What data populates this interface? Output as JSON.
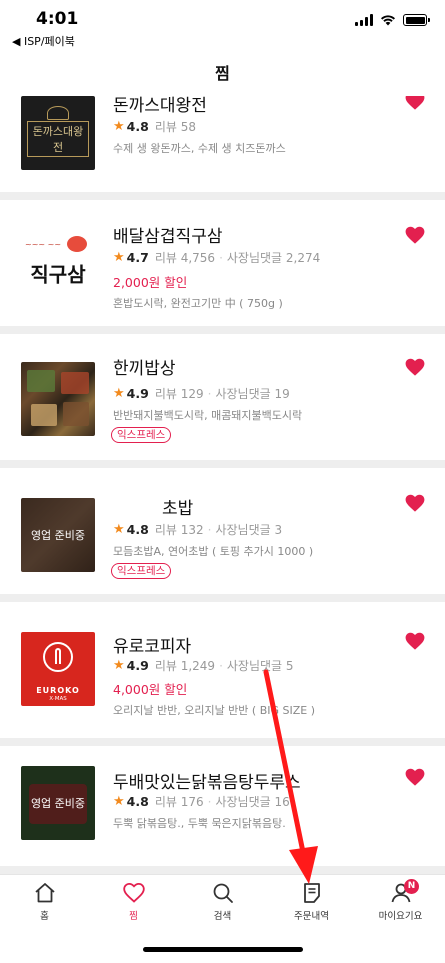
{
  "status_bar": {
    "time": "4:01",
    "back_app": "◀ ISP/페이북"
  },
  "header": {
    "title": "찜"
  },
  "colors": {
    "accent": "#e3204f",
    "star": "#f28a1e",
    "annotation_arrow": "#ff1a1a"
  },
  "stores": [
    {
      "name": "돈까스대왕전",
      "rating": "4.8",
      "review": "리뷰 58",
      "owner_reply": "",
      "discount": "",
      "menu": "수제 생 왕돈까스, 수제 생 치즈돈까스",
      "badge": "",
      "thumb_text": "돈까스대왕전",
      "thumb_caption": ""
    },
    {
      "name": "배달삼겹직구삼",
      "rating": "4.7",
      "review": "리뷰 4,756",
      "owner_reply": "사장님댓글 2,274",
      "discount": "2,000원 할인",
      "menu": "혼밥도시락, 완전고기만 中 ( 750g )",
      "badge": "",
      "thumb_text": "직구삼",
      "thumb_caption": ""
    },
    {
      "name": "한끼밥상",
      "rating": "4.9",
      "review": "리뷰 129",
      "owner_reply": "사장님댓글 19",
      "discount": "",
      "menu": "반반돼지불백도시락, 매콤돼지불백도시락",
      "badge": "익스프레스",
      "thumb_text": "",
      "thumb_caption": ""
    },
    {
      "name": "초밥",
      "rating": "4.8",
      "review": "리뷰 132",
      "owner_reply": "사장님댓글 3",
      "discount": "",
      "menu": "모듬초밥A, 연어초밥 ( 토핑 추가시 1000 )",
      "badge": "익스프레스",
      "thumb_text": "",
      "thumb_caption": "영업 준비중"
    },
    {
      "name": "유로코피자",
      "rating": "4.9",
      "review": "리뷰 1,249",
      "owner_reply": "사장님댓글 5",
      "discount": "4,000원 할인",
      "menu": "오리지날 반반, 오리지날 반반 ( BIG SIZE )",
      "badge": "",
      "thumb_text": "EUROKO",
      "thumb_caption": "X·MAS"
    },
    {
      "name": "두배맛있는닭볶음탕두루스",
      "rating": "4.8",
      "review": "리뷰 176",
      "owner_reply": "사장님댓글 16",
      "discount": "",
      "menu": "두뿍 닭볶음탕., 두뿍 묵은지닭볶음탕.",
      "badge": "",
      "thumb_text": "",
      "thumb_caption": "영업 준비중"
    }
  ],
  "tabs": [
    {
      "label": "홈",
      "icon": "home-icon"
    },
    {
      "label": "찜",
      "icon": "heart-icon",
      "active": true
    },
    {
      "label": "검색",
      "icon": "search-icon"
    },
    {
      "label": "주문내역",
      "icon": "receipt-icon"
    },
    {
      "label": "마이요기요",
      "icon": "person-icon",
      "badge": "N"
    }
  ]
}
